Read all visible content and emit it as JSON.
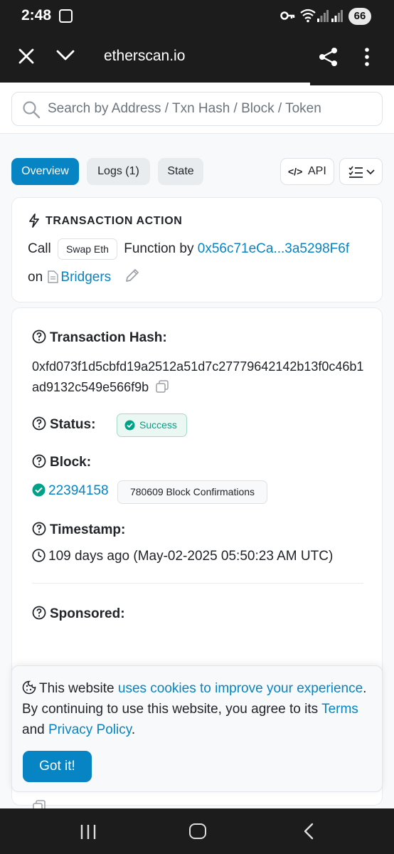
{
  "status_bar": {
    "time": "2:48",
    "battery": "66"
  },
  "browser": {
    "url": "etherscan.io"
  },
  "search": {
    "placeholder": "Search by Address / Txn Hash / Block / Token"
  },
  "tabs": [
    {
      "label": "Overview",
      "active": true
    },
    {
      "label": "Logs (1)",
      "active": false
    },
    {
      "label": "State",
      "active": false
    }
  ],
  "toolbar": {
    "api_label": "API",
    "api_code": "</>"
  },
  "transaction_action": {
    "title": "TRANSACTION ACTION",
    "call": "Call",
    "method": "Swap Eth",
    "function_by": "Function by",
    "address": "0x56c71eCa...3a5298F6f",
    "on": "on",
    "contract": "Bridgers"
  },
  "details": {
    "hash_label": "Transaction Hash:",
    "hash": "0xfd073f1d5cbfd19a2512a51d7c27779642142b13f0c46b1ad9132c549e566f9b",
    "status_label": "Status:",
    "status": "Success",
    "block_label": "Block:",
    "block": "22394158",
    "confirmations": "780609 Block Confirmations",
    "timestamp_label": "Timestamp:",
    "timestamp": "109 days ago (May-02-2025 05:50:23 AM UTC)",
    "sponsored_label": "Sponsored:"
  },
  "cookie_banner": {
    "text_1": "This website ",
    "link_1": "uses cookies to improve your experience",
    "text_2": ". By continuing to use this website, you agree to its ",
    "link_2": "Terms",
    "text_3": " and ",
    "link_3": "Privacy Policy",
    "text_4": ".",
    "button": "Got it!"
  },
  "colors": {
    "accent": "#0784c3",
    "success": "#00a186",
    "system_bar": "#1c1c1c"
  }
}
